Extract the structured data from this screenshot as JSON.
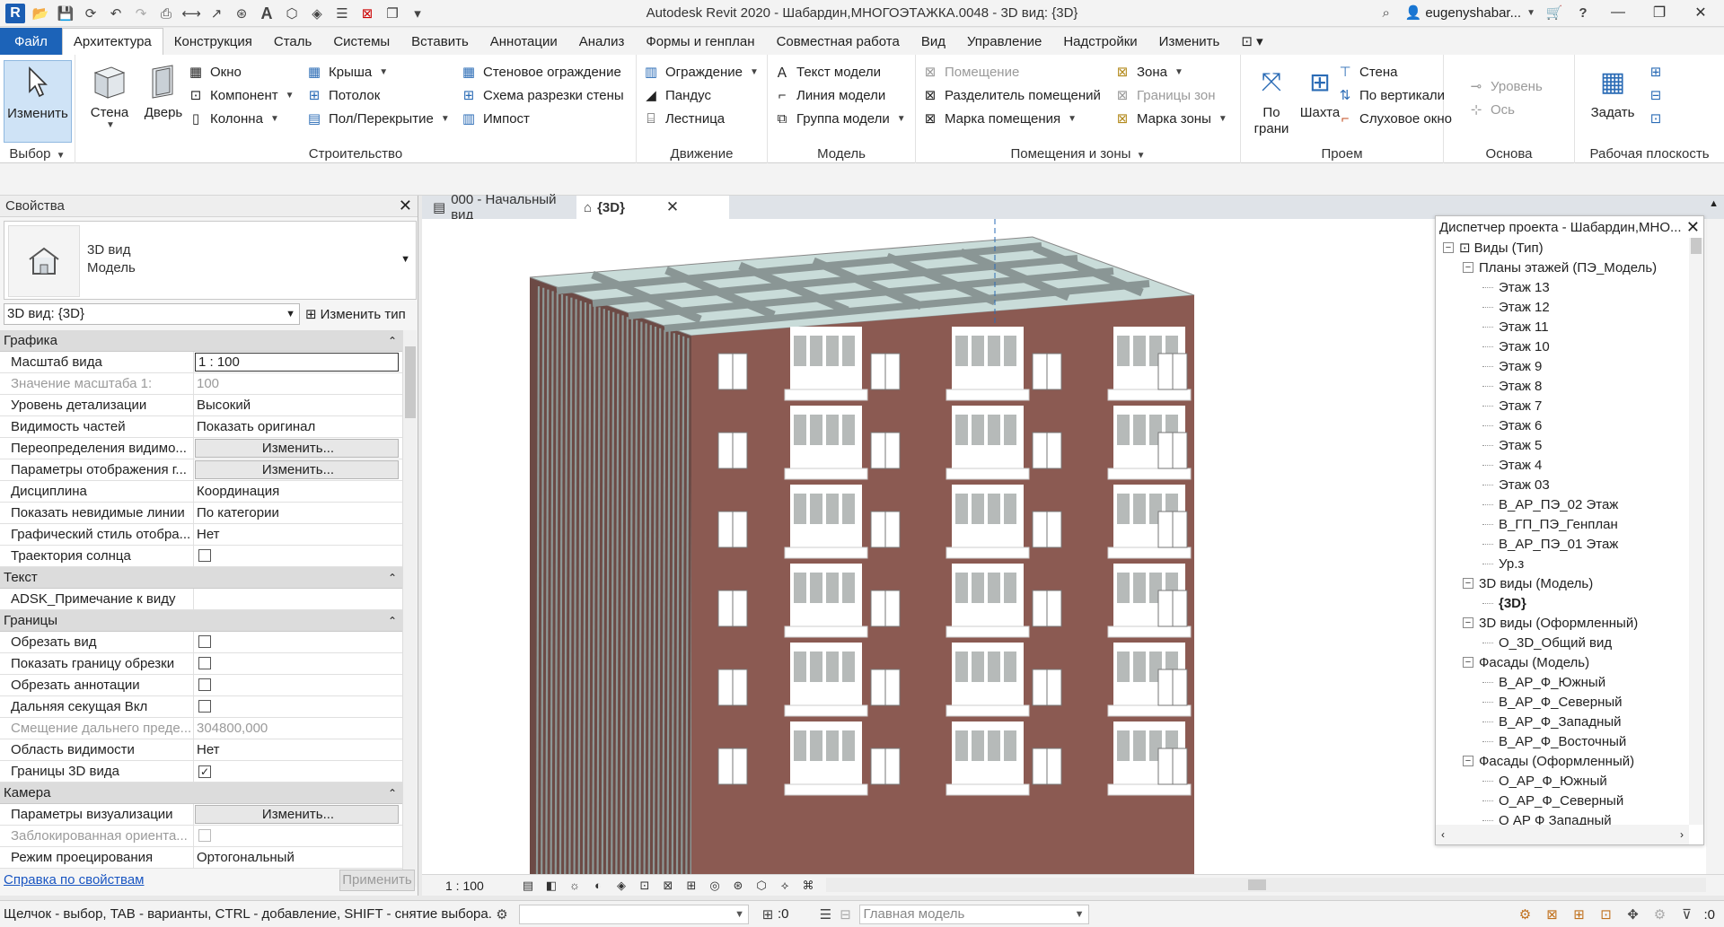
{
  "window": {
    "title": "Autodesk Revit 2020 - Шабардин,МНОГОЭТАЖКА.0048 - 3D вид: {3D}",
    "user": "eugenyshabar...",
    "logo_letter": "R"
  },
  "tabs": [
    "Файл",
    "Архитектура",
    "Конструкция",
    "Сталь",
    "Системы",
    "Вставить",
    "Аннотации",
    "Анализ",
    "Формы и генплан",
    "Совместная работа",
    "Вид",
    "Управление",
    "Надстройки",
    "Изменить"
  ],
  "ribbon": {
    "select": {
      "modify": "Изменить",
      "title": "Выбор"
    },
    "build": {
      "title": "Строительство",
      "wall": "Стена",
      "door": "Дверь",
      "window": "Окно",
      "component": "Компонент",
      "column": "Колонна",
      "roof": "Крыша",
      "ceiling": "Потолок",
      "floor": "Пол/Перекрытие",
      "curtain_system": "Стеновое ограждение",
      "curtain_grid": "Схема разрезки стены",
      "mullion": "Импост"
    },
    "circulation": {
      "title": "Движение",
      "railing": "Ограждение",
      "ramp": "Пандус",
      "stair": "Лестница"
    },
    "model": {
      "title": "Модель",
      "model_text": "Текст модели",
      "model_line": "Линия  модели",
      "model_group": "Группа модели"
    },
    "rooms": {
      "title": "Помещения и зоны",
      "room": "Помещение",
      "room_separator": "Разделитель помещений",
      "room_tag": "Марка помещения",
      "area": "Зона",
      "area_boundary": "Границы  зон",
      "area_tag": "Марка  зоны"
    },
    "opening": {
      "title": "Проем",
      "by_face": "По\nграни",
      "shaft": "Шахта",
      "wall": "Стена",
      "vertical": "По вертикали",
      "dormer": "Слуховое окно"
    },
    "datum": {
      "title": "Основа",
      "level": "Уровень",
      "grid": "Ось"
    },
    "workplane": {
      "title": "Рабочая плоскость",
      "set": "Задать"
    }
  },
  "properties": {
    "title": "Свойства",
    "type_name": "3D вид",
    "type_sub": "Модель",
    "view_selector": "3D вид: {3D}",
    "edit_type": "Изменить тип",
    "help": "Справка по свойствам",
    "apply": "Применить",
    "sections": [
      {
        "name": "Графика",
        "rows": [
          {
            "n": "Масштаб вида",
            "v": "1 : 100",
            "kind": "boxed"
          },
          {
            "n": "Значение масштаба    1:",
            "v": "100",
            "kind": "dim"
          },
          {
            "n": "Уровень детализации",
            "v": "Высокий"
          },
          {
            "n": "Видимость частей",
            "v": "Показать оригинал"
          },
          {
            "n": "Переопределения видимо...",
            "v": "Изменить...",
            "kind": "button"
          },
          {
            "n": "Параметры отображения г...",
            "v": "Изменить...",
            "kind": "button"
          },
          {
            "n": "Дисциплина",
            "v": "Координация"
          },
          {
            "n": "Показать невидимые линии",
            "v": "По категории"
          },
          {
            "n": "Графический стиль отобра...",
            "v": "Нет"
          },
          {
            "n": "Траектория солнца",
            "v": "",
            "kind": "check"
          }
        ]
      },
      {
        "name": "Текст",
        "rows": [
          {
            "n": "ADSK_Примечание к виду",
            "v": ""
          }
        ]
      },
      {
        "name": "Границы",
        "rows": [
          {
            "n": "Обрезать вид",
            "v": "",
            "kind": "check"
          },
          {
            "n": "Показать границу обрезки",
            "v": "",
            "kind": "check"
          },
          {
            "n": "Обрезать аннотации",
            "v": "",
            "kind": "check"
          },
          {
            "n": "Дальняя секущая Вкл",
            "v": "",
            "kind": "check"
          },
          {
            "n": "Смещение дальнего преде...",
            "v": "304800,000",
            "kind": "dim"
          },
          {
            "n": "Область видимости",
            "v": "Нет"
          },
          {
            "n": "Границы 3D вида",
            "v": "✓",
            "kind": "checked"
          }
        ]
      },
      {
        "name": "Камера",
        "rows": [
          {
            "n": "Параметры визуализации",
            "v": "Изменить...",
            "kind": "button"
          },
          {
            "n": "Заблокированная ориента...",
            "v": "",
            "kind": "checkdim"
          },
          {
            "n": "Режим проецирования",
            "v": "Ортогональный"
          }
        ]
      }
    ]
  },
  "doc_tabs": [
    {
      "label": "000 - Начальный вид",
      "active": false
    },
    {
      "label": "{3D}",
      "active": true
    }
  ],
  "view_scale": "1 : 100",
  "browser": {
    "title": "Диспетчер проекта - Шабардин,МНО...",
    "items": [
      {
        "label": "Виды (Тип)",
        "level": 0,
        "toggle": "−"
      },
      {
        "label": "Планы этажей (ПЭ_Модель)",
        "level": 1,
        "toggle": "−"
      },
      {
        "label": "Этаж 13",
        "level": 2
      },
      {
        "label": "Этаж 12",
        "level": 2
      },
      {
        "label": "Этаж 11",
        "level": 2
      },
      {
        "label": "Этаж 10",
        "level": 2
      },
      {
        "label": "Этаж 9",
        "level": 2
      },
      {
        "label": "Этаж 8",
        "level": 2
      },
      {
        "label": "Этаж 7",
        "level": 2
      },
      {
        "label": "Этаж 6",
        "level": 2
      },
      {
        "label": "Этаж 5",
        "level": 2
      },
      {
        "label": "Этаж 4",
        "level": 2
      },
      {
        "label": "Этаж 03",
        "level": 2
      },
      {
        "label": "В_АР_ПЭ_02 Этаж",
        "level": 2
      },
      {
        "label": "В_ГП_ПЭ_Генплан",
        "level": 2
      },
      {
        "label": "В_АР_ПЭ_01 Этаж",
        "level": 2
      },
      {
        "label": "Ур.з",
        "level": 2
      },
      {
        "label": "3D виды (Модель)",
        "level": 1,
        "toggle": "−"
      },
      {
        "label": "{3D}",
        "level": 2,
        "bold": true
      },
      {
        "label": "3D виды (Оформленный)",
        "level": 1,
        "toggle": "−"
      },
      {
        "label": "О_3D_Общий вид",
        "level": 2
      },
      {
        "label": "Фасады (Модель)",
        "level": 1,
        "toggle": "−"
      },
      {
        "label": "В_АР_Ф_Южный",
        "level": 2
      },
      {
        "label": "В_АР_Ф_Северный",
        "level": 2
      },
      {
        "label": "В_АР_Ф_Западный",
        "level": 2
      },
      {
        "label": "В_АР_Ф_Восточный",
        "level": 2
      },
      {
        "label": "Фасады (Оформленный)",
        "level": 1,
        "toggle": "−"
      },
      {
        "label": "О_АР_Ф_Южный",
        "level": 2
      },
      {
        "label": "О_АР_Ф_Северный",
        "level": 2
      },
      {
        "label": "О АР Ф Западный",
        "level": 2
      }
    ]
  },
  "status": {
    "hint": "Щелчок - выбор, TAB - варианты, CTRL - добавление, SHIFT - снятие выбора.",
    "count": ":0",
    "model": "Главная модель",
    "filter_count": ":0"
  },
  "colors": {
    "accent": "#1c63b8",
    "brick": "#8b5a52",
    "dark_wall": "#6c4a45",
    "roof": "#c9dcd9",
    "panel_gray": "#b6bab9"
  }
}
